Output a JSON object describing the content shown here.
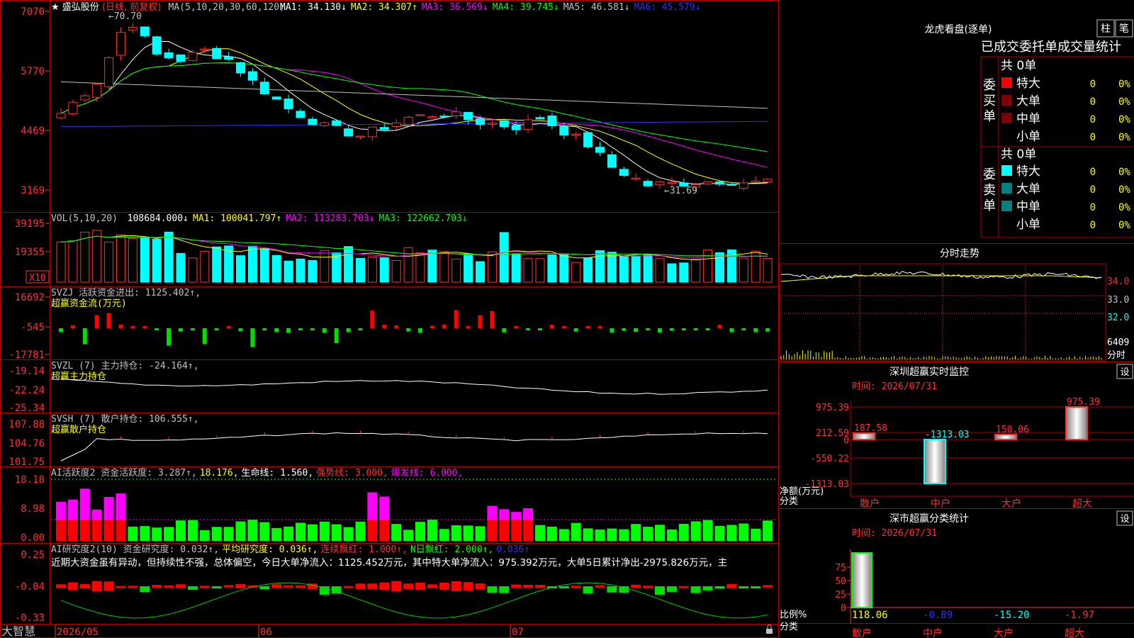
{
  "stock": {
    "star": "★",
    "name": "盛弘股份",
    "period": "(日线, 前复权)",
    "ma_title": "MA(5,10,20,30,60,120)",
    "ma_items": [
      {
        "label": "MA1: 34.130↓",
        "color": "#ffffff"
      },
      {
        "label": "MA2: 34.307↑",
        "color": "#ffff00"
      },
      {
        "label": "MA3: 36.569↓",
        "color": "#ff00ff"
      },
      {
        "label": "MA4: 39.745↓",
        "color": "#00ff00"
      },
      {
        "label": "MA5: 46.581↓",
        "color": "#c0c0c0"
      },
      {
        "label": "MA6: 45.579↓",
        "color": "#3030ff"
      }
    ],
    "y_labels": [
      "7070",
      "5770",
      "4469",
      "3169"
    ],
    "high_mark": "70.70",
    "low_mark": "31.69"
  },
  "vol": {
    "title": "VOL(5,10,20)",
    "value": "108684.000↓",
    "items": [
      {
        "label": "MA1: 100041.797↑",
        "color": "#ffff00"
      },
      {
        "label": "MA2: 113283.703↓",
        "color": "#ff00ff"
      },
      {
        "label": "MA3: 122662.703↓",
        "color": "#00ff00"
      }
    ],
    "y_labels": [
      "39195",
      "19355"
    ],
    "unit": "X10"
  },
  "svzj": {
    "title": "SVZJ  活跃资金进出: 1125.402↑,",
    "subtitle": "超赢资金流(万元)",
    "y_labels": [
      "16692",
      "-545",
      "-17781"
    ]
  },
  "svzl": {
    "title": "SVZL (7) 主力持仓: -24.164↑,",
    "subtitle": "超赢主力持仓",
    "y_labels": [
      "-19.14",
      "-22.24",
      "-25.34"
    ]
  },
  "svsh": {
    "title": "SVSH (7) 散户持仓: 106.555↑,",
    "subtitle": "超赢散户持仓",
    "y_labels": [
      "107.88",
      "104.76",
      "101.75"
    ]
  },
  "ai1": {
    "items": [
      {
        "label": "AI活跃度2 资金活跃度: 3.287↑,",
        "color": "#c0c0c0"
      },
      {
        "label": "18.176,",
        "color": "#ffff00"
      },
      {
        "label": "生命线: 1.560,",
        "color": "#ffffff"
      },
      {
        "label": "强势线: 3.000,",
        "color": "#ff3030"
      },
      {
        "label": "爆发线: 6.000,",
        "color": "#ff00ff"
      }
    ],
    "y_labels": [
      "18.18",
      "8.98",
      "0.00"
    ]
  },
  "ai2": {
    "items": [
      {
        "label": "AI研究度2(10) 资金研究度: 0.032↑,",
        "color": "#c0c0c0"
      },
      {
        "label": "平均研究度: 0.036↑,",
        "color": "#ffff00"
      },
      {
        "label": "连续飘红: 1.000↑,",
        "color": "#ff3030"
      },
      {
        "label": "N日飘红: 2.000↑,",
        "color": "#00ff00"
      },
      {
        "label": "0.036↑",
        "color": "#3030ff"
      }
    ],
    "comment": "近期大资金虽有异动，但持续性不强，总体偏空，今日大单净流入：1125.452万元，其中特大单净流入：975.392万元，大单5日累计净出-2975.826万元，主",
    "y_labels": [
      "0.25",
      "-0.04",
      "-0.33"
    ]
  },
  "xaxis": {
    "brand": "大智慧",
    "months": [
      "2026/05",
      "06",
      "07"
    ]
  },
  "lhb": {
    "title": "龙虎看盘(逐单)",
    "btn_zhu": "柱",
    "btn_bi": "笔",
    "header": "已成交委托单成交量统计",
    "buy_label": "委买单",
    "sell_label": "委卖单",
    "buy_total": "共 0单",
    "sell_total": "共 0单",
    "buy_rows": [
      {
        "name": "特大",
        "count": "0",
        "pct": "0%",
        "color": "#ff0000"
      },
      {
        "name": "大单",
        "count": "0",
        "pct": "0%",
        "color": "#800000"
      },
      {
        "name": "中单",
        "count": "0",
        "pct": "0%",
        "color": "#800000"
      },
      {
        "name": "小单",
        "count": "0",
        "pct": "0%",
        "color": ""
      }
    ],
    "sell_rows": [
      {
        "name": "特大",
        "count": "0",
        "pct": "0%",
        "color": "#00ffff"
      },
      {
        "name": "大单",
        "count": "0",
        "pct": "0%",
        "color": "#008080"
      },
      {
        "name": "中单",
        "count": "0",
        "pct": "0%",
        "color": "#008080"
      },
      {
        "name": "小单",
        "count": "0",
        "pct": "0%",
        "color": ""
      }
    ]
  },
  "fenshi": {
    "title": "分时走势",
    "y_labels": [
      "34.0",
      "33.0",
      "32.0",
      "6409",
      "分时"
    ]
  },
  "sz_monitor": {
    "title": "深圳超赢实时监控",
    "btn": "设",
    "time": "时间: 2026/07/31",
    "y_labels": [
      "975.39",
      "212.59",
      "0",
      "-550.22",
      "-1313.03"
    ],
    "ylabel1": "净额(万元)",
    "ylabel2": "分类",
    "bars": [
      {
        "cat": "散户",
        "value": 187.58,
        "label": "187.58",
        "label_color": "#ff3030"
      },
      {
        "cat": "中户",
        "value": -1313.03,
        "label": "-1313.03",
        "label_color": "#00ffff"
      },
      {
        "cat": "大户",
        "value": 150.06,
        "label": "150.06",
        "label_color": "#ff3030"
      },
      {
        "cat": "超大",
        "value": 975.39,
        "label": "975.39",
        "label_color": "#ff3030"
      }
    ]
  },
  "sz_class": {
    "title": "深市超赢分类统计",
    "btn": "设",
    "time": "时间: 2026/07/31",
    "y_labels": [
      "75",
      "50",
      "25",
      "0"
    ],
    "ylabel1": "比例%",
    "ylabel2": "分类",
    "values": [
      {
        "cat": "散户",
        "label": "118.06",
        "color": "#ffff00"
      },
      {
        "cat": "中户",
        "label": "-0.89",
        "color": "#3030ff"
      },
      {
        "cat": "大户",
        "label": "-15.20",
        "color": "#00ffff"
      },
      {
        "cat": "超大",
        "label": "-1.97",
        "color": "#ff3030"
      }
    ]
  }
}
